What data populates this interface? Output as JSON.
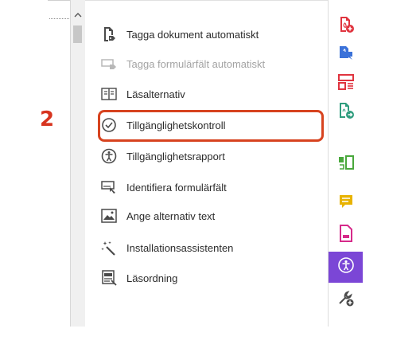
{
  "step_marker": "2",
  "menu": {
    "items": [
      {
        "label": "Tagga dokument automatiskt",
        "icon": "tag-document-icon",
        "enabled": true
      },
      {
        "label": "Tagga formulärfält automatiskt",
        "icon": "tag-form-fields-icon",
        "enabled": false
      },
      {
        "label": "Läsalternativ",
        "icon": "reading-options-icon",
        "enabled": true
      },
      {
        "label": "Tillgänglighetskontroll",
        "icon": "accessibility-check-icon",
        "enabled": true,
        "highlighted": true
      },
      {
        "label": "Tillgänglighetsrapport",
        "icon": "accessibility-report-icon",
        "enabled": true
      },
      {
        "label": "Identifiera formulärfält",
        "icon": "identify-form-fields-icon",
        "enabled": true
      },
      {
        "label": "Ange alternativ text",
        "icon": "alt-text-icon",
        "enabled": true
      },
      {
        "label": "Installationsassistenten",
        "icon": "setup-assistant-icon",
        "enabled": true
      },
      {
        "label": "Läsordning",
        "icon": "reading-order-icon",
        "enabled": true
      }
    ]
  },
  "tools": [
    {
      "icon": "create-pdf-icon",
      "color": "#e0343f"
    },
    {
      "icon": "export-pdf-icon",
      "color": "#3b72d9"
    },
    {
      "icon": "organize-pages-icon",
      "color": "#e0343f"
    },
    {
      "icon": "share-pdf-icon",
      "color": "#2f9d7e"
    },
    {
      "icon": "compare-files-icon",
      "color": "#49a83c"
    },
    {
      "icon": "comment-icon",
      "color": "#e8b300"
    },
    {
      "icon": "fill-sign-icon",
      "color": "#d62a8a"
    },
    {
      "icon": "accessibility-icon",
      "color": "#ffffff",
      "active": true
    },
    {
      "icon": "more-tools-icon",
      "color": "#4a4a4a"
    }
  ],
  "colors": {
    "highlight": "#d7431f",
    "active_tool_bg": "#7b46d6"
  }
}
